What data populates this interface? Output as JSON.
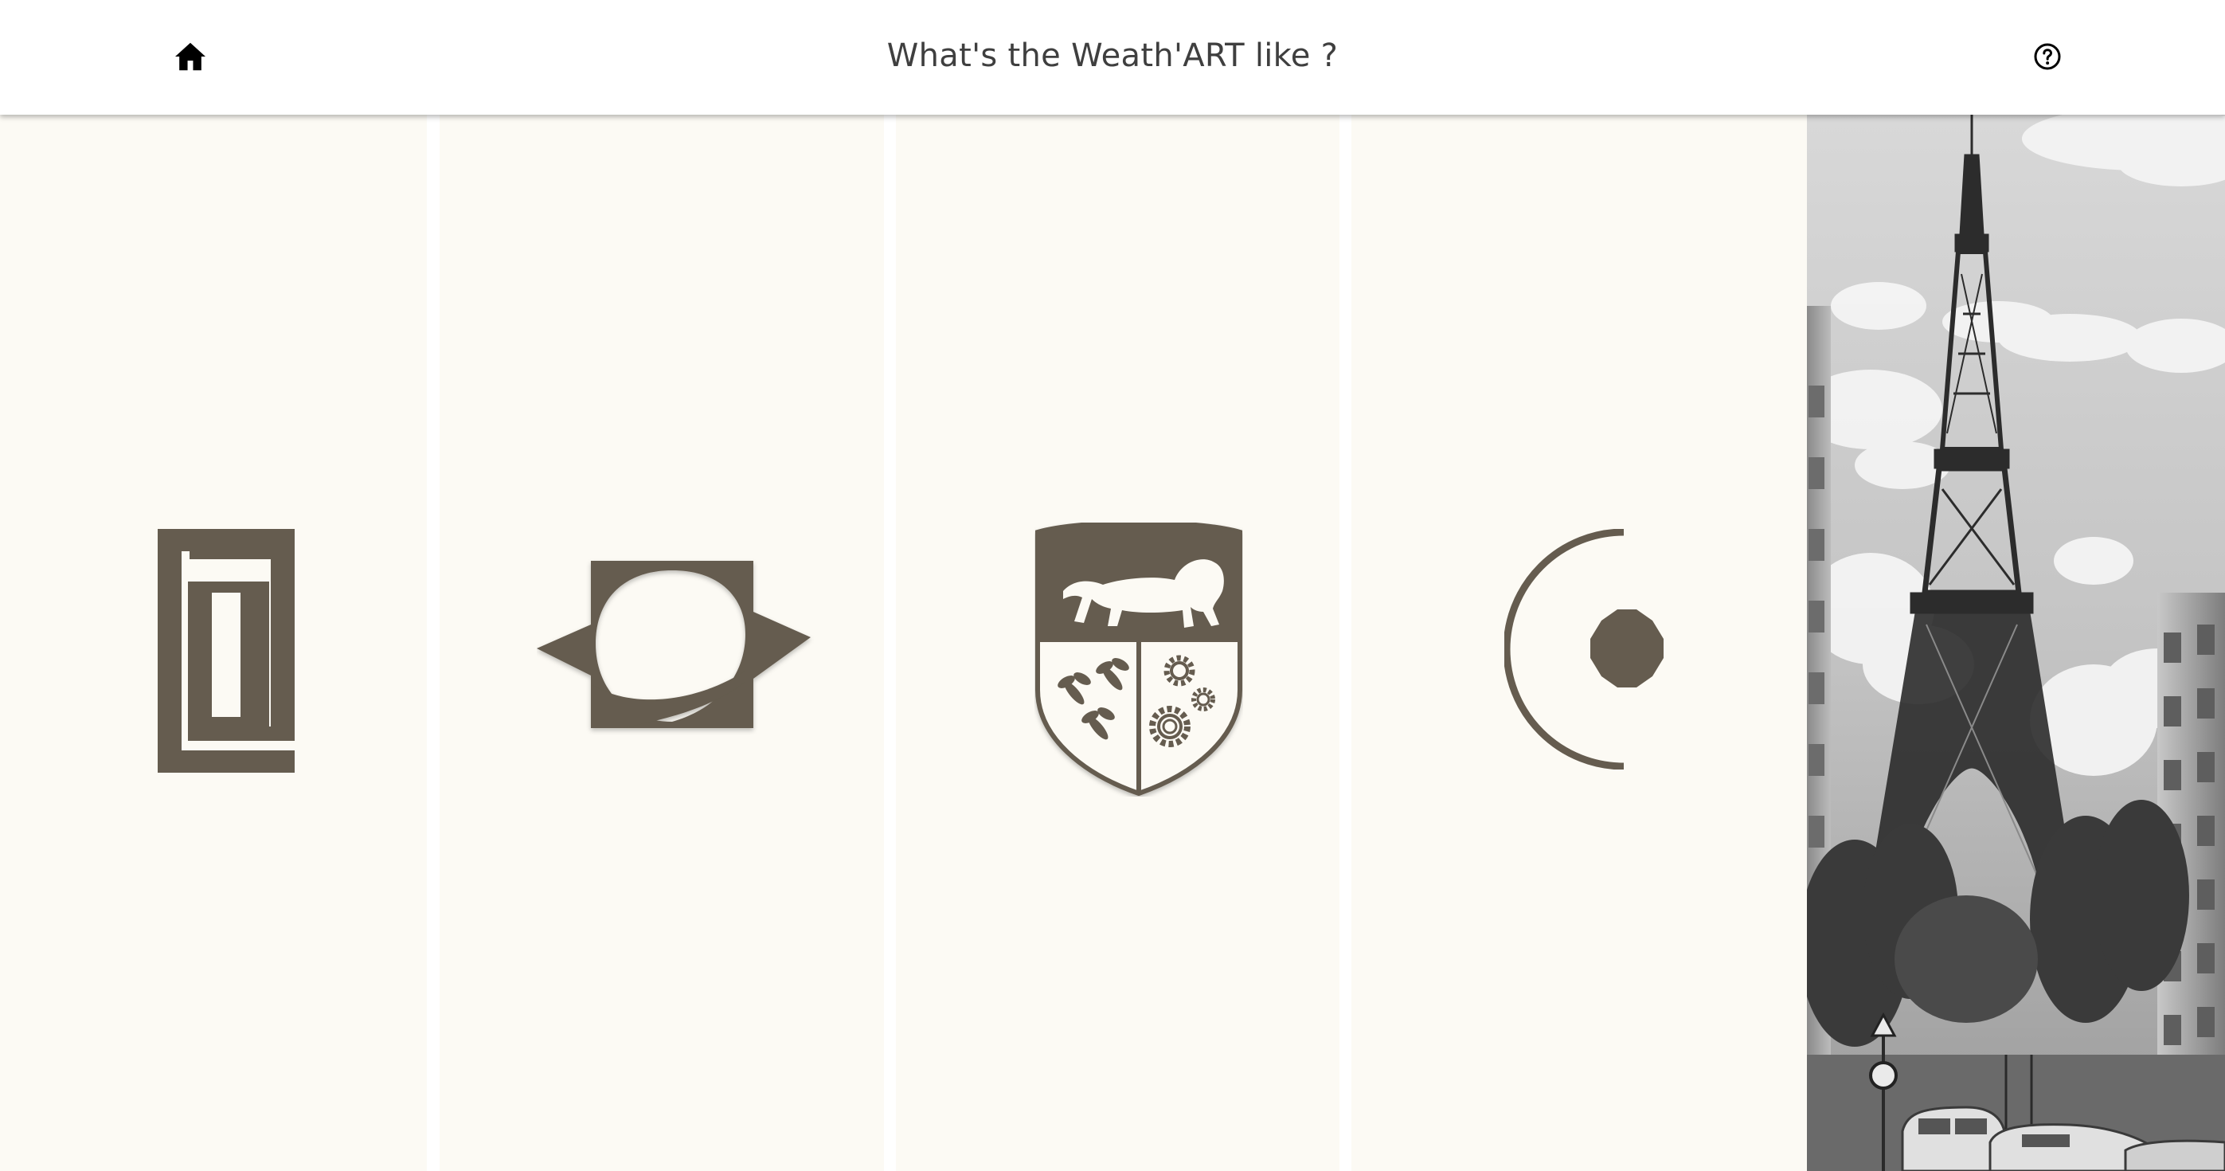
{
  "header": {
    "title": "What's the Weath'ART like ?",
    "home_icon": "home-icon",
    "help_icon": "question-circle-icon"
  },
  "panels": [
    {
      "style": "art-deco",
      "icon": "meander-emblem-icon"
    },
    {
      "style": "space-age",
      "icon": "planet-star-emblem-icon"
    },
    {
      "style": "heraldic",
      "icon": "lion-shield-crest-icon"
    },
    {
      "style": "minimalist",
      "icon": "crescent-dot-emblem-icon"
    }
  ],
  "photo": {
    "subject": "eiffel-tower-street-photo"
  },
  "colors": {
    "panel_bg": "#fcfaf4",
    "emblem": "#655c4f",
    "header_bg": "#ffffff",
    "title_text": "#3f3f3f"
  }
}
